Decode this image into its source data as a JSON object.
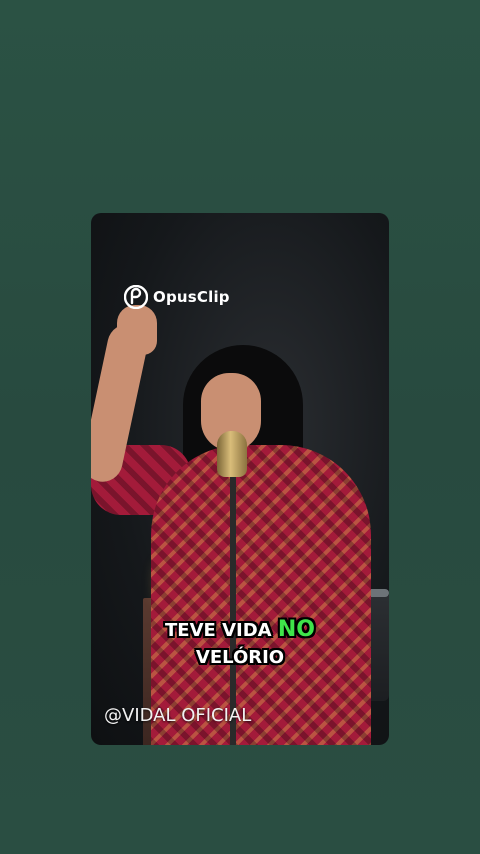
{
  "video": {
    "watermark_text": "OpusClip",
    "watermark_icon": "opusclip-logo-icon",
    "caption": {
      "line1_prefix": "TEVE VIDA",
      "line1_highlight": "NO",
      "line2": "VELÓRIO",
      "highlight_color": "#3fe44a",
      "text_color": "#ffffff"
    },
    "channel_handle": "@VIDAL OFICIAL"
  },
  "colors": {
    "background": "#2a4e42"
  }
}
